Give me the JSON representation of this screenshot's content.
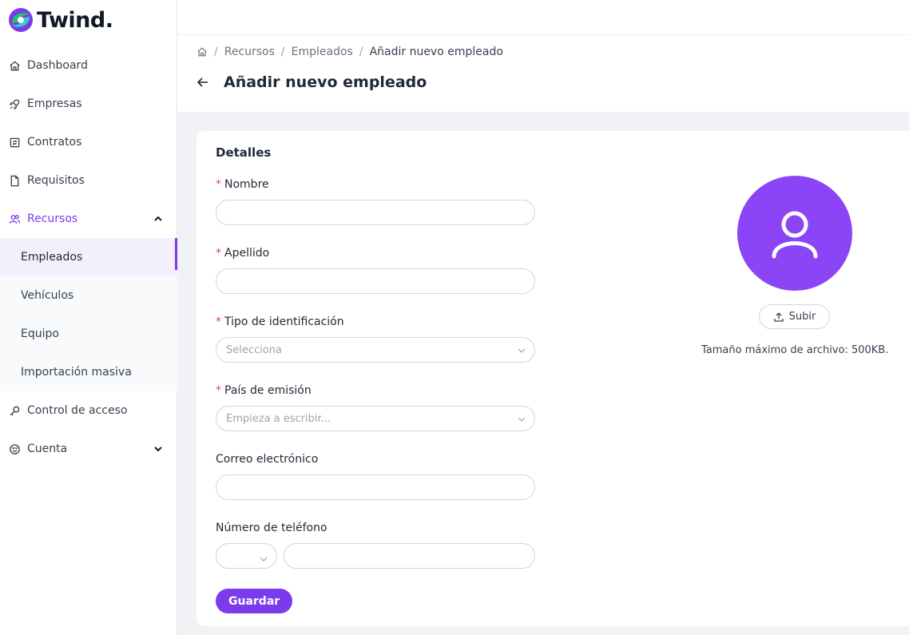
{
  "app": {
    "name": "Twind."
  },
  "sidebar": {
    "items": [
      {
        "label": "Dashboard",
        "icon": "home-icon"
      },
      {
        "label": "Empresas",
        "icon": "rocket-icon"
      },
      {
        "label": "Contratos",
        "icon": "contract-icon"
      },
      {
        "label": "Requisitos",
        "icon": "document-icon"
      },
      {
        "label": "Recursos",
        "icon": "users-icon",
        "expanded": true
      },
      {
        "label": "Control de acceso",
        "icon": "key-icon"
      },
      {
        "label": "Cuenta",
        "icon": "smile-icon"
      }
    ],
    "sub_items": [
      {
        "label": "Empleados",
        "selected": true
      },
      {
        "label": "Vehículos"
      },
      {
        "label": "Equipo"
      },
      {
        "label": "Importación masiva"
      }
    ]
  },
  "breadcrumb": {
    "items": [
      "Recursos",
      "Empleados"
    ],
    "current": "Añadir nuevo empleado"
  },
  "page": {
    "title": "Añadir nuevo empleado"
  },
  "form": {
    "section_title": "Detalles",
    "fields": {
      "nombre": {
        "label": "Nombre",
        "required": true,
        "value": ""
      },
      "apellido": {
        "label": "Apellido",
        "required": true,
        "value": ""
      },
      "tipo_id": {
        "label": "Tipo de identificación",
        "required": true,
        "placeholder": "Selecciona"
      },
      "pais": {
        "label": "País de emisión",
        "required": true,
        "placeholder": "Empieza a escribir..."
      },
      "correo": {
        "label": "Correo electrónico",
        "required": false,
        "value": ""
      },
      "telefono": {
        "label": "Número de teléfono",
        "required": false,
        "value": ""
      }
    },
    "save_label": "Guardar",
    "upload_label": "Subir",
    "max_size_text": "Tamaño máximo de archivo: 500KB."
  },
  "colors": {
    "accent": "#7c3aed",
    "avatar": "#8b45f7",
    "required": "#ef4444"
  }
}
